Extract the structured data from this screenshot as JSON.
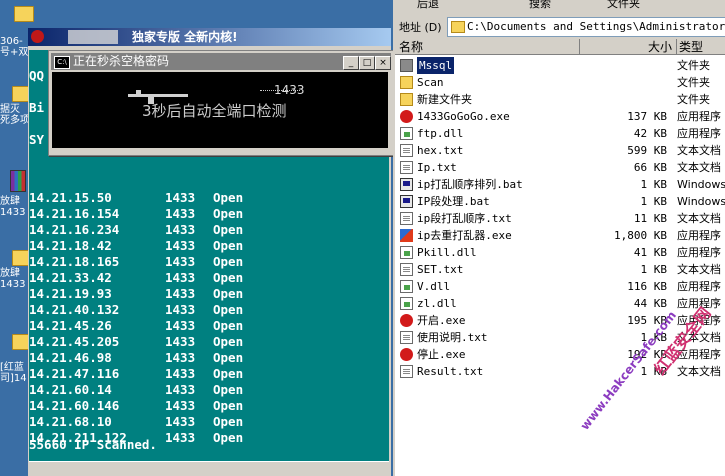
{
  "desktop": {
    "labels": [
      "306-",
      "号+双",
      "据灭",
      "死多项",
      "放肆",
      "1433",
      "放肆",
      "1433",
      "[红蓝",
      "司]14"
    ]
  },
  "app": {
    "title": "独家专版  全新内核!"
  },
  "console": {
    "side_labels": [
      "QQ",
      "Bi",
      "SY"
    ],
    "rows": [
      {
        "ip": "14.21.15.50",
        "port": "1433",
        "status": "Open"
      },
      {
        "ip": "14.21.16.154",
        "port": "1433",
        "status": "Open"
      },
      {
        "ip": "14.21.16.234",
        "port": "1433",
        "status": "Open"
      },
      {
        "ip": "14.21.18.42",
        "port": "1433",
        "status": "Open"
      },
      {
        "ip": "14.21.18.165",
        "port": "1433",
        "status": "Open"
      },
      {
        "ip": "14.21.33.42",
        "port": "1433",
        "status": "Open"
      },
      {
        "ip": "14.21.19.93",
        "port": "1433",
        "status": "Open"
      },
      {
        "ip": "14.21.40.132",
        "port": "1433",
        "status": "Open"
      },
      {
        "ip": "14.21.45.26",
        "port": "1433",
        "status": "Open"
      },
      {
        "ip": "14.21.45.205",
        "port": "1433",
        "status": "Open"
      },
      {
        "ip": "14.21.46.98",
        "port": "1433",
        "status": "Open"
      },
      {
        "ip": "14.21.47.116",
        "port": "1433",
        "status": "Open"
      },
      {
        "ip": "14.21.60.14",
        "port": "1433",
        "status": "Open"
      },
      {
        "ip": "14.21.60.146",
        "port": "1433",
        "status": "Open"
      },
      {
        "ip": "14.21.68.10",
        "port": "1433",
        "status": "Open"
      },
      {
        "ip": "14.21.211.122",
        "port": "1433",
        "status": "Open"
      }
    ],
    "summary": "55660 IP Scanned."
  },
  "popup": {
    "title": "正在秒杀空格密码",
    "port": "1433",
    "message": "3秒后自动全端口检测",
    "buttons": [
      "_",
      "□",
      "×"
    ]
  },
  "explorer": {
    "toolbar": [
      "后退",
      "搜索",
      "文件夹"
    ],
    "address_label": "地址 (D)",
    "address_value": "C:\\Documents and Settings\\Administrator\\桌面",
    "columns": {
      "name": "名称",
      "size": "大小",
      "type": "类型"
    },
    "files": [
      {
        "name": "Mssql",
        "size": "",
        "type": "文件夹",
        "icon": "folder-grey-icon",
        "selected": true
      },
      {
        "name": "Scan",
        "size": "",
        "type": "文件夹",
        "icon": "folder-icon"
      },
      {
        "name": "新建文件夹",
        "size": "",
        "type": "文件夹",
        "icon": "folder-icon"
      },
      {
        "name": "1433GoGoGo.exe",
        "size": "137 KB",
        "type": "应用程序",
        "icon": "exe-icon"
      },
      {
        "name": "ftp.dll",
        "size": "42 KB",
        "type": "应用程序",
        "icon": "dll-icon"
      },
      {
        "name": "hex.txt",
        "size": "599 KB",
        "type": "文本文档",
        "icon": "text-file-icon"
      },
      {
        "name": "Ip.txt",
        "size": "66 KB",
        "type": "文本文档",
        "icon": "text-file-icon"
      },
      {
        "name": "ip打乱顺序排列.bat",
        "size": "1 KB",
        "type": "Windows",
        "icon": "batch-file-icon"
      },
      {
        "name": "IP段处理.bat",
        "size": "1 KB",
        "type": "Windows",
        "icon": "batch-file-icon"
      },
      {
        "name": "ip段打乱顺序.txt",
        "size": "11 KB",
        "type": "文本文档",
        "icon": "text-file-icon"
      },
      {
        "name": "ip去重打乱器.exe",
        "size": "1,800 KB",
        "type": "应用程序",
        "icon": "app-exe-icon"
      },
      {
        "name": "Pkill.dll",
        "size": "41 KB",
        "type": "应用程序",
        "icon": "dll-icon"
      },
      {
        "name": "SET.txt",
        "size": "1 KB",
        "type": "文本文档",
        "icon": "text-file-icon"
      },
      {
        "name": "V.dll",
        "size": "116 KB",
        "type": "应用程序",
        "icon": "dll-icon"
      },
      {
        "name": "zl.dll",
        "size": "44 KB",
        "type": "应用程序",
        "icon": "dll-icon"
      },
      {
        "name": "开启.exe",
        "size": "195 KB",
        "type": "应用程序",
        "icon": "exe-icon"
      },
      {
        "name": "使用说明.txt",
        "size": "1 KB",
        "type": "文本文档",
        "icon": "text-file-icon"
      },
      {
        "name": "停止.exe",
        "size": "192 KB",
        "type": "应用程序",
        "icon": "exe-icon"
      },
      {
        "name": "Result.txt",
        "size": "1 KB",
        "type": "文本文档",
        "icon": "text-file-icon"
      }
    ]
  },
  "watermark": {
    "small": "www.HakcerSafe.com",
    "large": "红蓝安全网"
  }
}
